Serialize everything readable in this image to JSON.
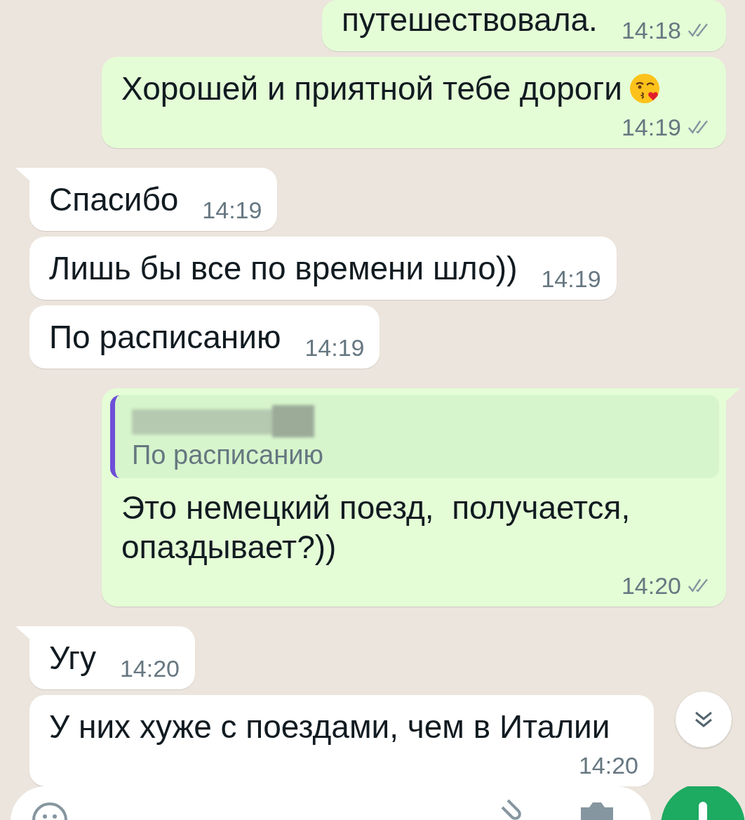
{
  "messages": [
    {
      "kind": "outgoing",
      "tail": false,
      "text": "путешествовала.",
      "time": "14:18",
      "read": false
    },
    {
      "kind": "outgoing",
      "tail": false,
      "text": "Хорошей и приятной тебе дороги",
      "emoji": true,
      "time": "14:19",
      "read": false
    },
    {
      "kind": "incoming",
      "tail": true,
      "text": "Спасибо",
      "time": "14:19"
    },
    {
      "kind": "incoming",
      "tail": false,
      "text": "Лишь бы все по времени шло))",
      "time": "14:19"
    },
    {
      "kind": "incoming",
      "tail": false,
      "text": "По расписанию",
      "time": "14:19"
    },
    {
      "kind": "outgoing",
      "tail": true,
      "reply": {
        "redacted": true,
        "text": "По расписанию"
      },
      "text": "Это немецкий поезд,  получается, опаздывает?))",
      "time": "14:20",
      "read": false
    },
    {
      "kind": "incoming",
      "tail": true,
      "text": "Угу",
      "time": "14:20"
    },
    {
      "kind": "incoming",
      "tail": false,
      "text": "У них хуже с поездами, чем в Италии",
      "time": "14:20"
    }
  ]
}
